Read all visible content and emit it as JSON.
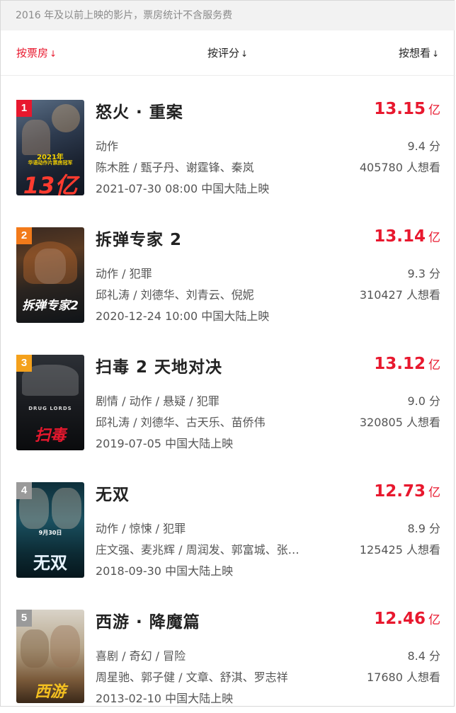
{
  "notice": "2016 年及以前上映的影片，票房统计不含服务费",
  "sort": {
    "box_office": "按票房",
    "rating": "按评分",
    "wish": "按想看",
    "arrow": "↓"
  },
  "colors": {
    "accent": "#e8182e",
    "rank_1": "#e8182e",
    "rank_2": "#f27a1a",
    "rank_3": "#f4a11c",
    "rank_other": "#9a9a9a"
  },
  "movies": [
    {
      "rank": "1",
      "title": "怒火 · 重案",
      "box_office": "13.15",
      "unit": "亿",
      "genre": "动作",
      "score": "9.4 分",
      "cast": "陈木胜 / 甄子丹、谢霆锋、秦岚",
      "wish": "405780 人想看",
      "release": "2021-07-30 08:00 中国大陆上映",
      "poster_text": [
        "2021年",
        "华语动作片票房冠军",
        "13亿"
      ]
    },
    {
      "rank": "2",
      "title": "拆弹专家 2",
      "box_office": "13.14",
      "unit": "亿",
      "genre": "动作 / 犯罪",
      "score": "9.3 分",
      "cast": "邱礼涛 / 刘德华、刘青云、倪妮",
      "wish": "310427 人想看",
      "release": "2020-12-24 10:00 中国大陆上映",
      "poster_text": [
        "拆弹专家2"
      ]
    },
    {
      "rank": "3",
      "title": "扫毒 2 天地对决",
      "box_office": "13.12",
      "unit": "亿",
      "genre": "剧情 / 动作 / 悬疑 / 犯罪",
      "score": "9.0 分",
      "cast": "邱礼涛 / 刘德华、古天乐、苗侨伟",
      "wish": "320805 人想看",
      "release": "2019-07-05 中国大陆上映",
      "poster_text": [
        "DRUG LORDS",
        "扫毒"
      ]
    },
    {
      "rank": "4",
      "title": "无双",
      "box_office": "12.73",
      "unit": "亿",
      "genre": "动作 / 惊悚 / 犯罪",
      "score": "8.9 分",
      "cast": "庄文强、麦兆辉 / 周润发、郭富城、张…",
      "wish": "125425 人想看",
      "release": "2018-09-30 中国大陆上映",
      "poster_text": [
        "9月30日",
        "无双"
      ]
    },
    {
      "rank": "5",
      "title": "西游 · 降魔篇",
      "box_office": "12.46",
      "unit": "亿",
      "genre": "喜剧 / 奇幻 / 冒险",
      "score": "8.4 分",
      "cast": "周星驰、郭子健 / 文章、舒淇、罗志祥",
      "wish": "17680 人想看",
      "release": "2013-02-10 中国大陆上映",
      "poster_text": [
        "西游"
      ]
    }
  ]
}
